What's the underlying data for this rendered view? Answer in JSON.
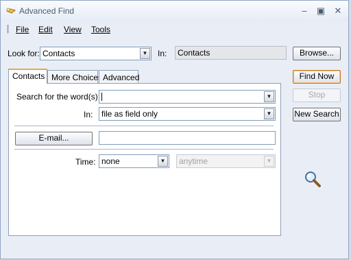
{
  "window": {
    "title": "Advanced Find"
  },
  "menu": {
    "file": "File",
    "edit": "Edit",
    "view": "View",
    "tools": "Tools"
  },
  "look_for": {
    "label": "Look for:",
    "value": "Contacts"
  },
  "in_top": {
    "label": "In:",
    "value": "Contacts"
  },
  "buttons": {
    "browse": "Browse...",
    "find_now": "Find Now",
    "stop": "Stop",
    "new_search": "New Search"
  },
  "tabs": [
    {
      "label": "Contacts"
    },
    {
      "label": "More Choices"
    },
    {
      "label": "Advanced"
    }
  ],
  "search": {
    "label": "Search for the word(s):",
    "value": ""
  },
  "in_field": {
    "label": "In:",
    "value": "file as field only"
  },
  "email": {
    "button": "E-mail...",
    "value": ""
  },
  "time": {
    "label": "Time:",
    "value": "none",
    "range": "anytime"
  },
  "colors": {
    "accent": "#e8a64a",
    "border": "#7f9db9",
    "background": "#e9eef6"
  }
}
